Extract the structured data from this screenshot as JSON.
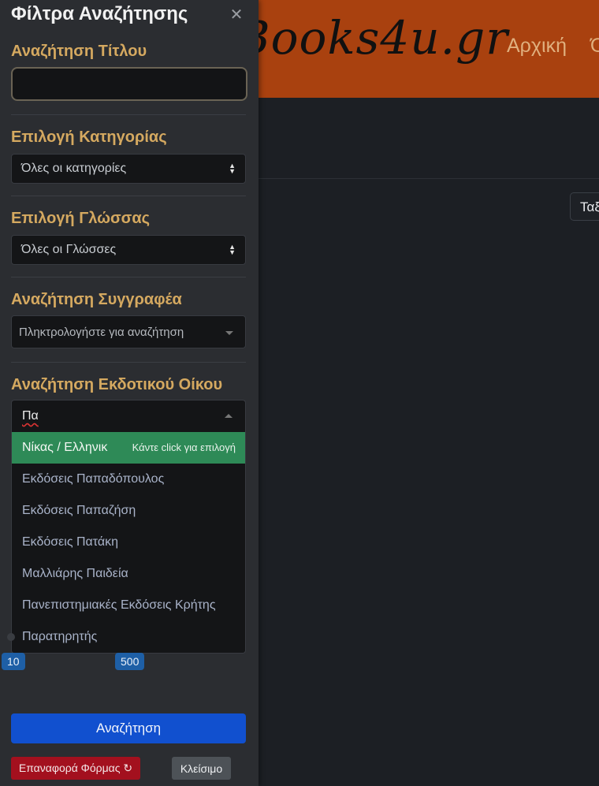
{
  "page": {
    "logo_text": "Books4u.gr",
    "nav": [
      "Αρχική",
      "Όλα"
    ],
    "sort_label": "Ταξινόμηση"
  },
  "filters": {
    "title": "Φίλτρα Αναζήτησης",
    "close_icon": "close-icon",
    "title_search": {
      "label": "Αναζήτηση Τίτλου",
      "value": ""
    },
    "category": {
      "label": "Επιλογή Κατηγορίας",
      "selected": "Όλες οι κατηγορίες"
    },
    "language": {
      "label": "Επιλογή Γλώσσας",
      "selected": "Όλες οι Γλώσσες"
    },
    "author": {
      "label": "Αναζήτηση Συγγραφέα",
      "placeholder": "Πληκτρολογήστε για αναζήτηση"
    },
    "publisher": {
      "label": "Αναζήτηση Εκδοτικού Οίκου",
      "typed": "Πα",
      "highlight_hint": "Κάντε click για επιλογή",
      "options": [
        "Νίκας / Ελληνικ",
        "Εκδόσεις Παπαδόπουλος",
        "Εκδόσεις Παπαζήση",
        "Εκδόσεις Πατάκη",
        "Μαλλιάρης Παιδεία",
        "Πανεπιστημιακές Εκδόσεις Κρήτης",
        "Παρατηρητής"
      ]
    },
    "range": {
      "min": "10",
      "max": "500"
    },
    "buttons": {
      "search": "Αναζήτηση",
      "reset": "Επαναφορά Φόρμας ↻",
      "close": "Κλείσιμο"
    }
  },
  "colors": {
    "header_bg": "#a9410f",
    "accent_label": "#d5a960",
    "highlight_green": "#2e8a57",
    "primary_blue": "#1150cf",
    "danger_red": "#a3101e"
  }
}
